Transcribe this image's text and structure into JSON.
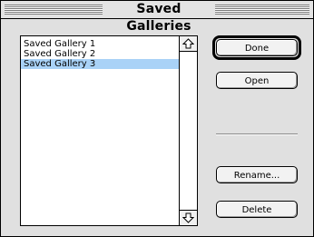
{
  "window": {
    "title": "Saved Galleries"
  },
  "gallery_list": {
    "items": [
      {
        "label": "Saved Gallery 1",
        "selected": false
      },
      {
        "label": "Saved Gallery 2",
        "selected": false
      },
      {
        "label": "Saved Gallery 3",
        "selected": true
      }
    ],
    "selected_color": "#a9d2f7"
  },
  "buttons": {
    "done": "Done",
    "open": "Open",
    "rename": "Rename...",
    "delete": "Delete"
  },
  "icons": {
    "scroll_up": "scroll-up-arrow-icon",
    "scroll_down": "scroll-down-arrow-icon"
  }
}
